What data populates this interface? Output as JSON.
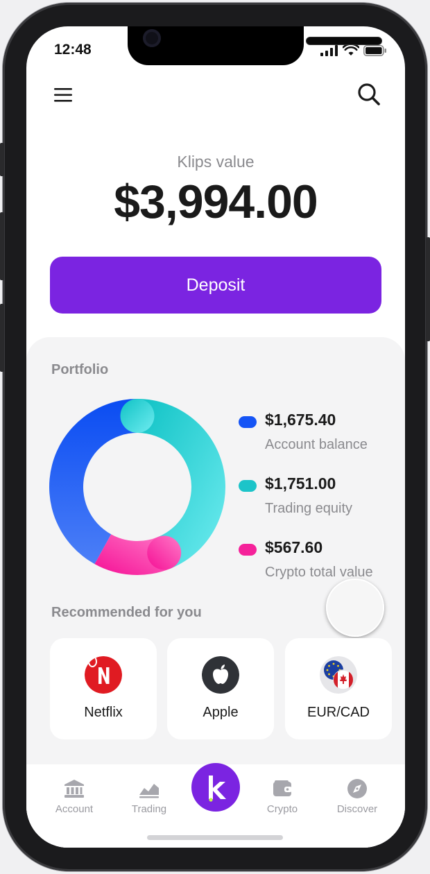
{
  "status": {
    "time": "12:48",
    "icons": [
      "cellular-signal-icon",
      "wifi-icon",
      "battery-icon"
    ]
  },
  "header": {
    "icons": [
      "menu-icon",
      "search-icon"
    ]
  },
  "summary": {
    "label": "Klips value",
    "amount": "$3,994.00",
    "deposit_label": "Deposit"
  },
  "portfolio": {
    "title": "Portfolio",
    "items": [
      {
        "amount": "$1,675.40",
        "label": "Account balance",
        "color": "#1554f5"
      },
      {
        "amount": "$1,751.00",
        "label": "Trading equity",
        "color": "#1cc4c9"
      },
      {
        "amount": "$567.60",
        "label": "Crypto total value",
        "color": "#f5229a"
      }
    ]
  },
  "chart_data": {
    "type": "pie",
    "categories": [
      "Account balance",
      "Trading equity",
      "Crypto total value"
    ],
    "values": [
      1675.4,
      1751.0,
      567.6
    ],
    "colors": [
      "#1554f5",
      "#1cc4c9",
      "#f5229a"
    ]
  },
  "recommended": {
    "title": "Recommended for you",
    "items": [
      {
        "name": "Netflix",
        "icon": "netflix-icon"
      },
      {
        "name": "Apple",
        "icon": "apple-icon"
      },
      {
        "name": "EUR/CAD",
        "icon": "eur-cad-flags-icon"
      }
    ]
  },
  "tabbar": {
    "tabs": [
      {
        "label": "Account",
        "icon": "bank-icon"
      },
      {
        "label": "Trading",
        "icon": "chart-icon"
      },
      {
        "label": "Crypto",
        "icon": "wallet-icon"
      },
      {
        "label": "Discover",
        "icon": "compass-icon"
      }
    ],
    "center_icon": "klips-logo-icon"
  }
}
